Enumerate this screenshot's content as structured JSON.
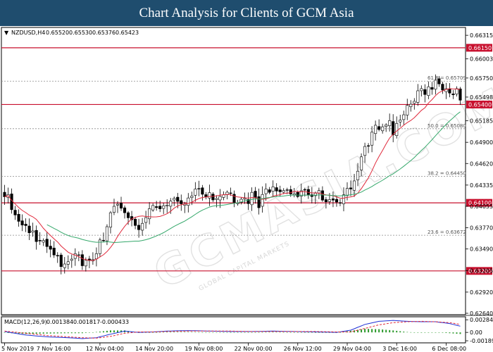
{
  "banner": {
    "title": "Chart Analysis for Clients of GCM Asia"
  },
  "watermark": {
    "text": "GCMASIA.COM",
    "subtext": "GLOBAL CAPITAL MARKETS"
  },
  "chart_data": {
    "type": "candlestick",
    "symbol_label": "NZDUSD,H4",
    "ohlc_header": [
      "0.65520",
      "0.65530",
      "0.65376",
      "0.65423"
    ],
    "price_axis": {
      "ylim": [
        0.6264,
        0.664
      ],
      "tick_labels": [
        "0.66315",
        "0.66003",
        "0.65750",
        "0.65498",
        "0.65185",
        "0.64900",
        "0.64620",
        "0.64335",
        "0.64055",
        "0.63770",
        "0.63490",
        "0.63205",
        "0.62920",
        "0.62640"
      ],
      "tick_values": [
        0.66315,
        0.66003,
        0.6575,
        0.65498,
        0.65185,
        0.649,
        0.6462,
        0.64335,
        0.64055,
        0.6377,
        0.6349,
        0.63205,
        0.6292,
        0.6264
      ]
    },
    "horizontal_levels": [
      {
        "value": 0.6615,
        "label": "0.66150",
        "color": "#c8102e"
      },
      {
        "value": 0.654,
        "label": "0.65400",
        "color": "#c8102e"
      },
      {
        "value": 0.641,
        "label": "0.64100",
        "color": "#c8102e"
      },
      {
        "value": 0.632,
        "label": "0.63200",
        "color": "#c8102e"
      }
    ],
    "fibonacci_levels": [
      {
        "value": 0.65709,
        "label": "61.8 = 0.65709"
      },
      {
        "value": 0.6508,
        "label": "50.0 = 0.65080"
      },
      {
        "value": 0.6445,
        "label": "38.2 = 0.64450"
      },
      {
        "value": 0.63672,
        "label": "23.6 = 0.63672"
      }
    ],
    "x_tick_labels": [
      "5 Nov 2019",
      "7 Nov 16:00",
      "12 Nov 04:00",
      "14 Nov 20:00",
      "19 Nov 08:00",
      "22 Nov 00:00",
      "26 Nov 12:00",
      "29 Nov 04:00",
      "3 Dec 16:00",
      "6 Dec 08:00"
    ],
    "x_tick_indices": [
      0,
      13,
      27,
      41,
      55,
      69,
      83,
      97,
      111,
      125
    ],
    "candle_count": 130,
    "close_path": [
      [
        0,
        0.6425
      ],
      [
        2,
        0.6405
      ],
      [
        4,
        0.6382
      ],
      [
        6,
        0.6378
      ],
      [
        8,
        0.637
      ],
      [
        10,
        0.636
      ],
      [
        12,
        0.6352
      ],
      [
        14,
        0.634
      ],
      [
        16,
        0.6328
      ],
      [
        18,
        0.6335
      ],
      [
        20,
        0.6342
      ],
      [
        22,
        0.633
      ],
      [
        24,
        0.6338
      ],
      [
        26,
        0.6345
      ],
      [
        28,
        0.6365
      ],
      [
        30,
        0.6398
      ],
      [
        32,
        0.6412
      ],
      [
        34,
        0.6395
      ],
      [
        36,
        0.6385
      ],
      [
        38,
        0.6378
      ],
      [
        40,
        0.6392
      ],
      [
        42,
        0.6402
      ],
      [
        44,
        0.6408
      ],
      [
        46,
        0.6412
      ],
      [
        48,
        0.641
      ],
      [
        50,
        0.6403
      ],
      [
        52,
        0.642
      ],
      [
        54,
        0.6432
      ],
      [
        56,
        0.6425
      ],
      [
        58,
        0.6418
      ],
      [
        60,
        0.641
      ],
      [
        62,
        0.6415
      ],
      [
        64,
        0.642
      ],
      [
        66,
        0.6409
      ],
      [
        68,
        0.6413
      ],
      [
        70,
        0.6418
      ],
      [
        72,
        0.641
      ],
      [
        74,
        0.6422
      ],
      [
        76,
        0.6428
      ],
      [
        78,
        0.6426
      ],
      [
        80,
        0.6425
      ],
      [
        82,
        0.6423
      ],
      [
        84,
        0.6419
      ],
      [
        86,
        0.6425
      ],
      [
        88,
        0.6422
      ],
      [
        90,
        0.6418
      ],
      [
        92,
        0.6414
      ],
      [
        94,
        0.6413
      ],
      [
        96,
        0.642
      ],
      [
        98,
        0.6432
      ],
      [
        100,
        0.6448
      ],
      [
        102,
        0.6482
      ],
      [
        104,
        0.6502
      ],
      [
        106,
        0.6512
      ],
      [
        108,
        0.652
      ],
      [
        110,
        0.6505
      ],
      [
        112,
        0.652
      ],
      [
        114,
        0.6535
      ],
      [
        116,
        0.6548
      ],
      [
        118,
        0.6555
      ],
      [
        120,
        0.6562
      ],
      [
        122,
        0.657
      ],
      [
        124,
        0.6565
      ],
      [
        126,
        0.6562
      ],
      [
        128,
        0.6555
      ],
      [
        129,
        0.6542
      ]
    ],
    "indicator": {
      "label": "MACD(12,26,9)",
      "values_label": [
        "0.001384",
        "0.001817",
        "-0.000433"
      ],
      "ylim": [
        -0.0022,
        0.0032
      ],
      "tick_labels": [
        "0.002847",
        "0.00",
        "-0.00189"
      ],
      "tick_values": [
        0.002847,
        0.0,
        -0.00189
      ],
      "macd_path": [
        [
          0,
          0.0002
        ],
        [
          6,
          -0.0006
        ],
        [
          12,
          -0.001
        ],
        [
          18,
          -0.0012
        ],
        [
          22,
          -0.0014
        ],
        [
          26,
          -0.0012
        ],
        [
          30,
          -0.0004
        ],
        [
          34,
          0.0003
        ],
        [
          38,
          0.0
        ],
        [
          42,
          0.0001
        ],
        [
          46,
          0.0003
        ],
        [
          52,
          0.0004
        ],
        [
          58,
          0.0003
        ],
        [
          64,
          0.0002
        ],
        [
          70,
          0.0002
        ],
        [
          76,
          0.0003
        ],
        [
          82,
          0.0002
        ],
        [
          88,
          0.0001
        ],
        [
          94,
          0.0
        ],
        [
          98,
          0.0005
        ],
        [
          102,
          0.0018
        ],
        [
          106,
          0.0025
        ],
        [
          110,
          0.0027
        ],
        [
          114,
          0.0025
        ],
        [
          118,
          0.0024
        ],
        [
          122,
          0.0024
        ],
        [
          126,
          0.002
        ],
        [
          129,
          0.0014
        ]
      ],
      "signal_path": [
        [
          0,
          0.0003
        ],
        [
          6,
          -0.0002
        ],
        [
          12,
          -0.0007
        ],
        [
          18,
          -0.001
        ],
        [
          22,
          -0.0012
        ],
        [
          26,
          -0.0013
        ],
        [
          30,
          -0.0009
        ],
        [
          34,
          -0.0002
        ],
        [
          38,
          0.0001
        ],
        [
          42,
          0.0001
        ],
        [
          46,
          0.0002
        ],
        [
          52,
          0.0003
        ],
        [
          58,
          0.0003
        ],
        [
          64,
          0.0003
        ],
        [
          70,
          0.0002
        ],
        [
          76,
          0.0002
        ],
        [
          82,
          0.0002
        ],
        [
          88,
          0.0002
        ],
        [
          94,
          0.0001
        ],
        [
          98,
          0.0001
        ],
        [
          102,
          0.0009
        ],
        [
          106,
          0.0017
        ],
        [
          110,
          0.0022
        ],
        [
          114,
          0.0024
        ],
        [
          118,
          0.0025
        ],
        [
          122,
          0.0024
        ],
        [
          126,
          0.0022
        ],
        [
          129,
          0.0018
        ]
      ]
    },
    "colors": {
      "bull_candle": "#ffffff",
      "bear_candle": "#000000",
      "fast_ma": "#e0293b",
      "slow_ma": "#35a86b",
      "level_line": "#c8102e",
      "macd_line": "#1f2fd6",
      "signal_line": "#e0293b",
      "histogram": "#2e9a2e",
      "banner_bg": "#1f4d6e"
    }
  }
}
